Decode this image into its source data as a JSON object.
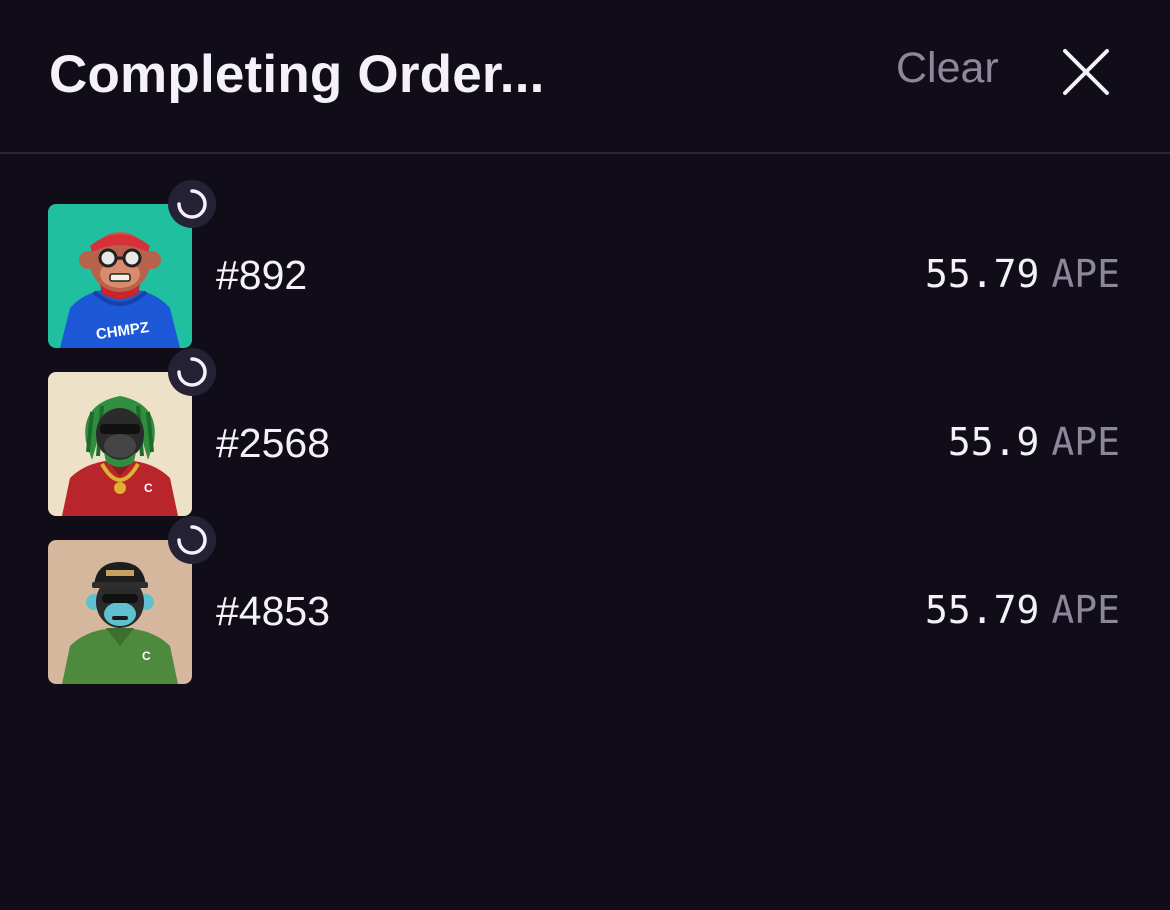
{
  "colors": {
    "background": "#100d19",
    "text_primary": "#f4f2f8",
    "text_muted": "#8d879b",
    "divider": "#2a2634",
    "spinner_bg": "#262235"
  },
  "header": {
    "title": "Completing Order...",
    "clear_label": "Clear",
    "close_icon": "close-icon"
  },
  "items": [
    {
      "token": "#892",
      "amount": "55.79",
      "currency": "APE",
      "status_icon": "loading-spinner-icon",
      "art_bg": "#1fbfa0"
    },
    {
      "token": "#2568",
      "amount": "55.9",
      "currency": "APE",
      "status_icon": "loading-spinner-icon",
      "art_bg": "#ede1c8"
    },
    {
      "token": "#4853",
      "amount": "55.79",
      "currency": "APE",
      "status_icon": "loading-spinner-icon",
      "art_bg": "#d5b79d"
    }
  ]
}
